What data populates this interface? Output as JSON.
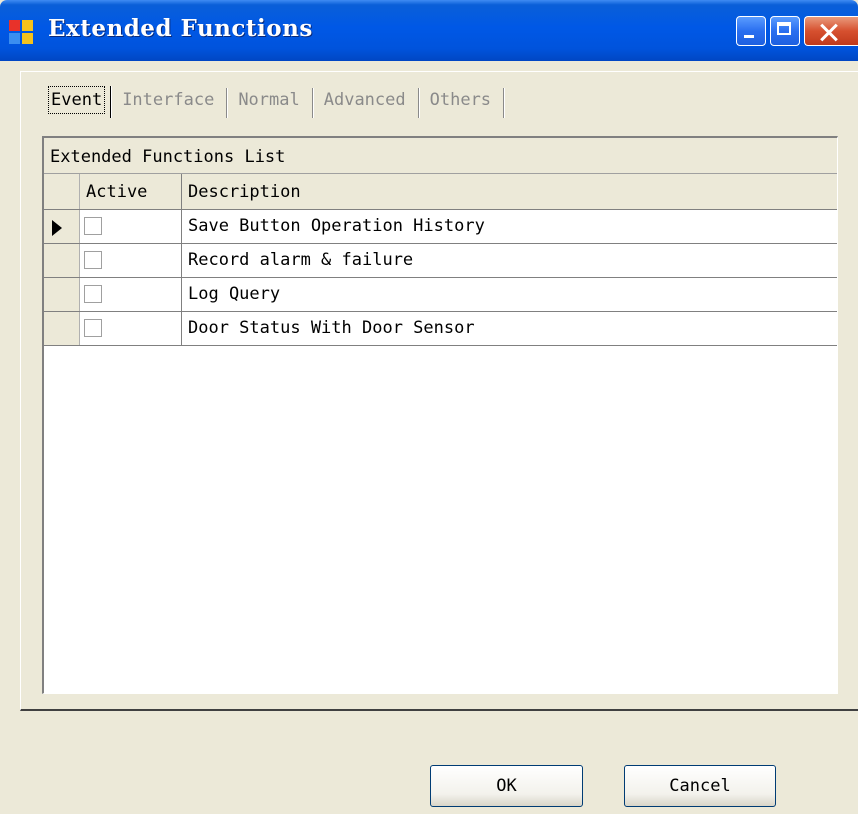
{
  "window": {
    "title": "Extended Functions",
    "icon": "app-window-icon",
    "controls": [
      "minimize-icon",
      "maximize-icon",
      "close-icon"
    ]
  },
  "tabs": [
    {
      "label": "Event",
      "active": true
    },
    {
      "label": "Interface",
      "active": false
    },
    {
      "label": "Normal",
      "active": false
    },
    {
      "label": "Advanced",
      "active": false
    },
    {
      "label": "Others",
      "active": false
    }
  ],
  "grid": {
    "caption": "Extended Functions List",
    "columns": [
      "Active",
      "Description"
    ],
    "rows": [
      {
        "active": false,
        "description": "Save Button Operation History",
        "current": true
      },
      {
        "active": false,
        "description": "Record alarm & failure",
        "current": false
      },
      {
        "active": false,
        "description": "Log Query",
        "current": false
      },
      {
        "active": false,
        "description": "Door Status With Door Sensor",
        "current": false
      }
    ]
  },
  "buttons": {
    "ok": "OK",
    "cancel": "Cancel"
  },
  "colors": {
    "titlebar": "#0058e6",
    "dialog_bg": "#ece9d8",
    "close_button": "#d6502f"
  }
}
